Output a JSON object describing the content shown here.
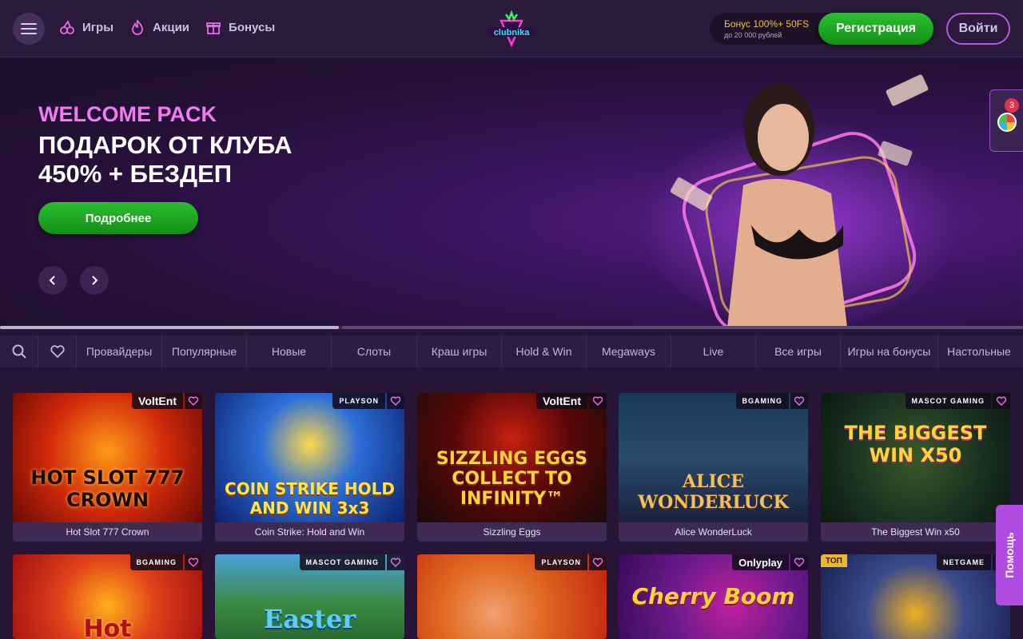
{
  "header": {
    "nav": [
      {
        "label": "Игры",
        "icon": "cherries-icon"
      },
      {
        "label": "Акции",
        "icon": "flame-icon"
      },
      {
        "label": "Бонусы",
        "icon": "gift-icon"
      }
    ],
    "logo_text": "clubnika",
    "bonus": {
      "line1": "Бонус 100%+ 50FS",
      "line2": "до 20 000 рублей"
    },
    "register_label": "Регистрация",
    "login_label": "Войти"
  },
  "banner": {
    "tag": "WELCOME PACK",
    "title_line1": "ПОДАРОК ОТ КЛУБА",
    "title_line2": "450% + БЕЗДЕП",
    "more_label": "Подробнее"
  },
  "side_widget": {
    "badge": "3"
  },
  "categories": [
    "Провайдеры",
    "Популярные",
    "Новые",
    "Слоты",
    "Краш игры",
    "Hold & Win",
    "Megaways",
    "Live",
    "Все игры",
    "Игры на бонусы",
    "Настольные"
  ],
  "games_row1": [
    {
      "title": "Hot Slot 777 Crown",
      "provider": "VoltEnt",
      "art": "HOT SLOT 777 CROWN"
    },
    {
      "title": "Coin Strike: Hold and Win",
      "provider": "PLAYSON",
      "art": "COIN STRIKE HOLD AND WIN 3x3"
    },
    {
      "title": "Sizzling Eggs",
      "provider": "VoltEnt",
      "art": "SIZZLING EGGS COLLECT TO INFINITY™"
    },
    {
      "title": "Alice WonderLuck",
      "provider": "BGAMING",
      "art": "ALICE WONDERLUCK"
    },
    {
      "title": "The Biggest Win x50",
      "provider": "MASCOT GAMING",
      "art": "THE BIGGEST WIN X50"
    }
  ],
  "games_row2": [
    {
      "provider": "BGAMING",
      "art": "Hot"
    },
    {
      "provider": "MASCOT GAMING",
      "art": "Easter"
    },
    {
      "provider": "PLAYSON",
      "art": ""
    },
    {
      "provider": "Onlyplay",
      "art": "Cherry Boom"
    },
    {
      "provider": "NETGAME",
      "art": "",
      "tag": "ТОП"
    }
  ],
  "help_label": "Помощь",
  "colors": {
    "accent": "#b24be0",
    "green": "#1fa823",
    "bg": "#261536",
    "gold": "#f4c32b"
  }
}
